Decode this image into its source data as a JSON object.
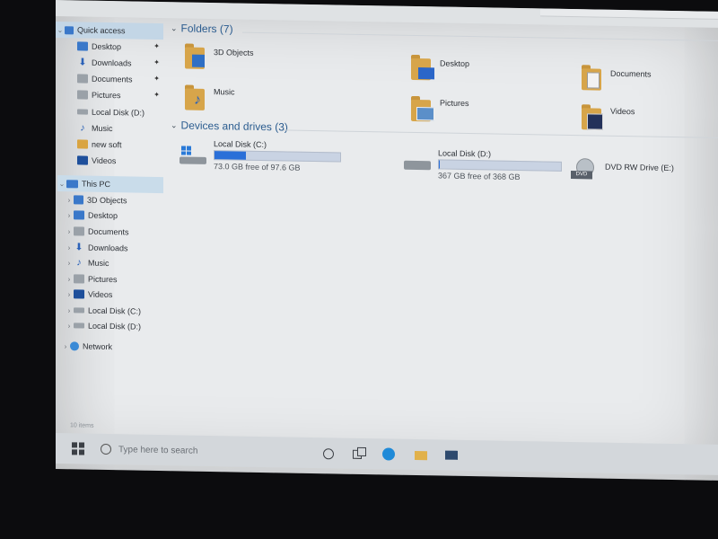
{
  "sidebar": {
    "quick_access": "Quick access",
    "quick_items": [
      {
        "label": "Desktop",
        "pinned": true,
        "icon": "desktop-icon"
      },
      {
        "label": "Downloads",
        "pinned": true,
        "icon": "downloads-icon"
      },
      {
        "label": "Documents",
        "pinned": true,
        "icon": "documents-icon"
      },
      {
        "label": "Pictures",
        "pinned": true,
        "icon": "pictures-icon"
      },
      {
        "label": "Local Disk (D:)",
        "pinned": false,
        "icon": "drive-icon"
      },
      {
        "label": "Music",
        "pinned": false,
        "icon": "music-icon"
      },
      {
        "label": "new soft",
        "pinned": false,
        "icon": "folder-icon"
      },
      {
        "label": "Videos",
        "pinned": false,
        "icon": "videos-icon"
      }
    ],
    "this_pc": "This PC",
    "pc_items": [
      {
        "label": "3D Objects",
        "icon": "3d-objects-icon"
      },
      {
        "label": "Desktop",
        "icon": "desktop-icon"
      },
      {
        "label": "Documents",
        "icon": "documents-icon"
      },
      {
        "label": "Downloads",
        "icon": "downloads-icon"
      },
      {
        "label": "Music",
        "icon": "music-icon"
      },
      {
        "label": "Pictures",
        "icon": "pictures-icon"
      },
      {
        "label": "Videos",
        "icon": "videos-icon"
      },
      {
        "label": "Local Disk (C:)",
        "icon": "drive-icon"
      },
      {
        "label": "Local Disk (D:)",
        "icon": "drive-icon"
      }
    ],
    "network": "Network"
  },
  "main": {
    "folders_header": "Folders (7)",
    "folders": [
      {
        "label": "3D Objects",
        "icon": "3d-objects-icon"
      },
      {
        "label": "Desktop",
        "icon": "desktop-icon"
      },
      {
        "label": "Documents",
        "icon": "documents-icon"
      },
      {
        "label": "Music",
        "icon": "music-icon"
      },
      {
        "label": "Pictures",
        "icon": "pictures-icon"
      },
      {
        "label": "Videos",
        "icon": "videos-icon"
      }
    ],
    "devices_header": "Devices and drives (3)",
    "drives": [
      {
        "name": "Local Disk (C:)",
        "free_text": "73.0 GB free of 97.6 GB",
        "used_fraction": 0.25,
        "icon": "windows-drive-icon"
      },
      {
        "name": "Local Disk (D:)",
        "free_text": "367 GB free of 368 GB",
        "used_fraction": 0.003,
        "icon": "drive-icon"
      },
      {
        "name": "DVD RW Drive (E:)",
        "icon": "dvd-drive-icon"
      }
    ]
  },
  "status": {
    "items": "10 items"
  },
  "taskbar": {
    "search_placeholder": "Type here to search",
    "icons": [
      "start-icon",
      "cortana-icon",
      "task-view-icon",
      "edge-icon",
      "file-explorer-icon",
      "mail-icon"
    ]
  },
  "colors": {
    "accent": "#2a6fd8",
    "folder": "#d7a54a",
    "link": "#2b5c8f"
  }
}
